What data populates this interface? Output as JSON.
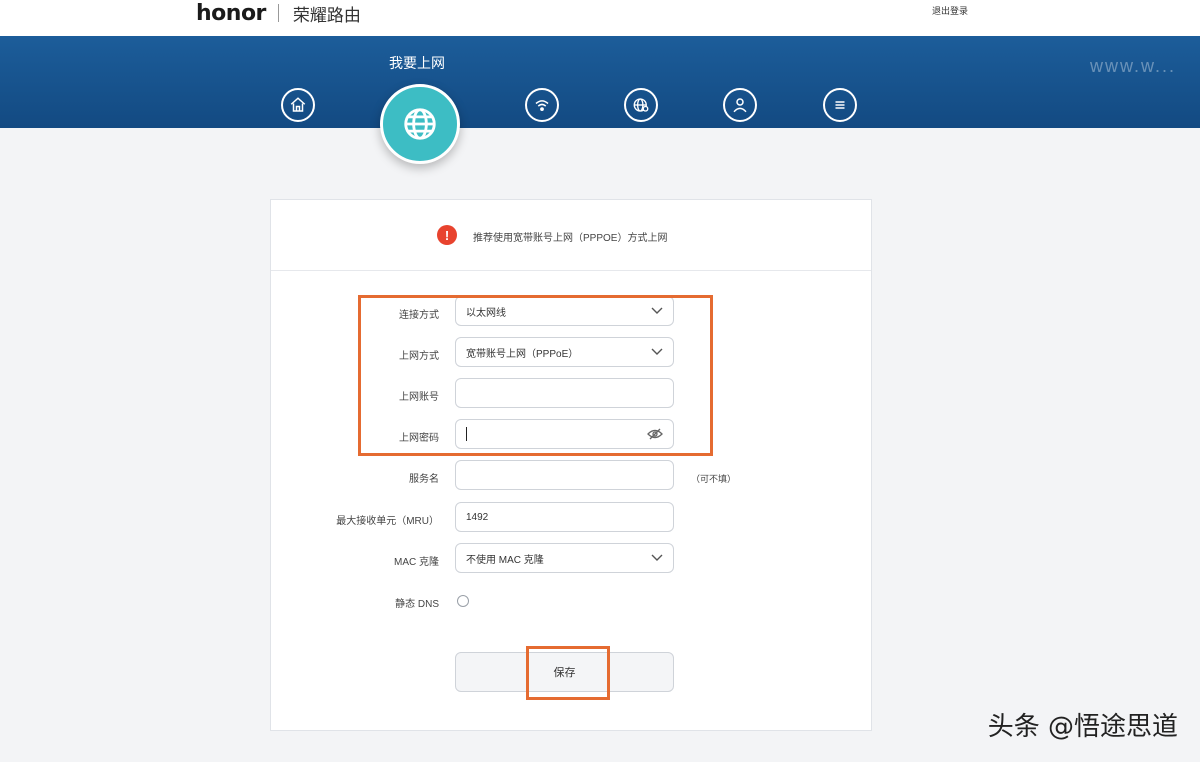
{
  "header": {
    "brand": "honor",
    "product": "荣耀路由",
    "logout": "退出登录"
  },
  "banner": {
    "watermark": "www.w..."
  },
  "nav": {
    "active_title": "我要上网",
    "items": [
      {
        "icon": "home-icon"
      },
      {
        "icon": "globe-icon",
        "active": true
      },
      {
        "icon": "wifi-icon"
      },
      {
        "icon": "globe-settings-icon"
      },
      {
        "icon": "user-icon"
      },
      {
        "icon": "menu-icon"
      }
    ]
  },
  "notice": {
    "icon": "!",
    "text": "推荐使用宽带账号上网（PPPOE）方式上网"
  },
  "form": {
    "connection_label": "连接方式",
    "connection_value": "以太网线",
    "mode_label": "上网方式",
    "mode_value": "宽带账号上网（PPPoE）",
    "account_label": "上网账号",
    "account_value": "",
    "password_label": "上网密码",
    "password_value": "",
    "service_label": "服务名",
    "service_value": "",
    "service_hint": "（可不填）",
    "mru_label": "最大接收单元（MRU）",
    "mru_value": "1492",
    "mac_label": "MAC 克隆",
    "mac_value": "不使用 MAC 克隆",
    "dns_label": "静态 DNS",
    "save_label": "保存"
  },
  "colors": {
    "band": "#1c5d9a",
    "active": "#3dbdc4",
    "highlight": "#e56b31",
    "alert": "#e8432e"
  },
  "footer": {
    "watermark": "头条 @悟途思道"
  }
}
